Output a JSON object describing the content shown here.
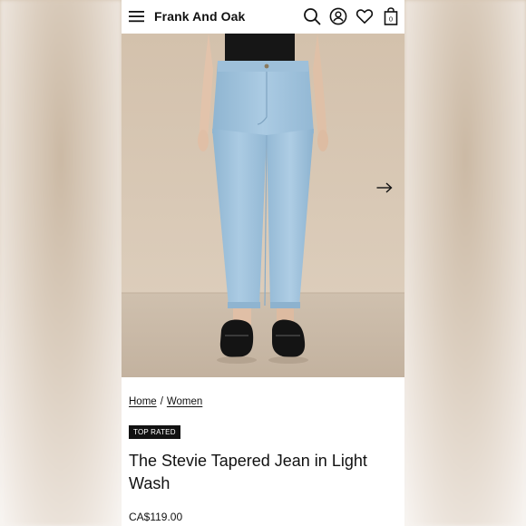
{
  "header": {
    "brand": "Frank And Oak",
    "menu_icon": "hamburger-menu-icon",
    "search_icon": "search-icon",
    "account_icon": "account-icon",
    "wishlist_icon": "heart-icon",
    "cart_icon": "shopping-bag-icon",
    "cart_count": "0"
  },
  "hero": {
    "next_icon": "arrow-right-icon"
  },
  "breadcrumb": {
    "items": [
      "Home",
      "Women"
    ],
    "separator": "/"
  },
  "product": {
    "badge": "TOP RATED",
    "title": "The Stevie Tapered Jean in Light Wash",
    "price": "CA$119.00"
  },
  "colors": {
    "jeans": "#9fc2dc",
    "studio_wall": "#d8c7b3",
    "floor": "#c7b7a4",
    "badge_bg": "#111111"
  }
}
